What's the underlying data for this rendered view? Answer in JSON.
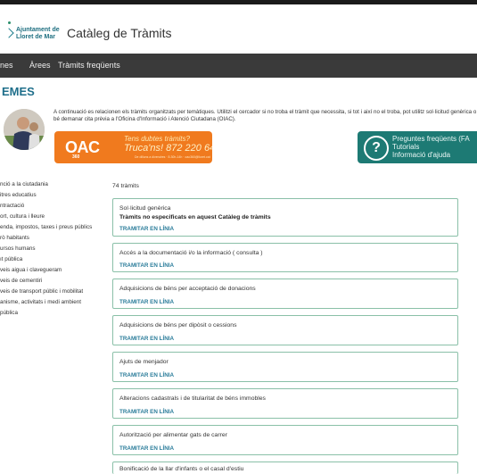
{
  "header": {
    "logo_line1": "Ajuntament de",
    "logo_line2": "Lloret de Mar",
    "site_title": "Catàleg de Tràmits"
  },
  "nav": {
    "items": [
      "nes",
      "Àrees",
      "Tràmits freqüents"
    ]
  },
  "page": {
    "title": "EMES",
    "intro": "A continuació es relacionen els tràmits organitzats per temàtiques. Utilitzi el cercador si no troba el tràmit que necessita, si tot i així no el troba, pot utilitz sol·licitud genèrica o bé demanar cita prèvia a l'Oficina d'Informació i Atenció Ciutadana (OIAC)."
  },
  "oac_banner": {
    "logo": "OAC",
    "logo_sub": "360",
    "line1": "Tens dubtes tràmits?",
    "line2": "Truca'ns! 872 220 646",
    "line3": "De dilluns a divendres · 8.30h-14h · oac360@lloret.cat"
  },
  "faq_banner": {
    "line1": "Preguntes freqüents (FA",
    "line2": "Tutorials",
    "line3": "Informació d'ajuda"
  },
  "sidebar": {
    "items": [
      "nció a la ciutadania",
      "itres educatius",
      "ntractació",
      "ort, cultura i lleure",
      "enda, impostos, taxes i preus públics",
      "rò habitants",
      "ursos humans",
      "ıt pública",
      "veis aigua i clavegueram",
      "veis de cementiri",
      "veis de transport públic i mobilitat",
      "anisme, activitats i medi ambient",
      "pública"
    ]
  },
  "results": {
    "count": "74 tràmits",
    "button_label": "TRAMITAR EN LÍNIA",
    "items": [
      {
        "title": "Sol·licitud genèrica",
        "subtitle": "Tràmits no especificats en aquest Catàleg de tràmits"
      },
      {
        "title": "Accés a la documentació i/o la informació ( consulta )"
      },
      {
        "title": "Adquisicions de béns per acceptació de donacions"
      },
      {
        "title": "Adquisicions de béns per dipòsit o cessions"
      },
      {
        "title": "Ajuts de menjador"
      },
      {
        "title": "Alteracions cadastrals i de titularitat de béns immobles"
      },
      {
        "title": "Autorització per alimentar gats de carrer"
      },
      {
        "title": "Bonificació de la llar d'infants o el casal d'estiu"
      }
    ]
  }
}
